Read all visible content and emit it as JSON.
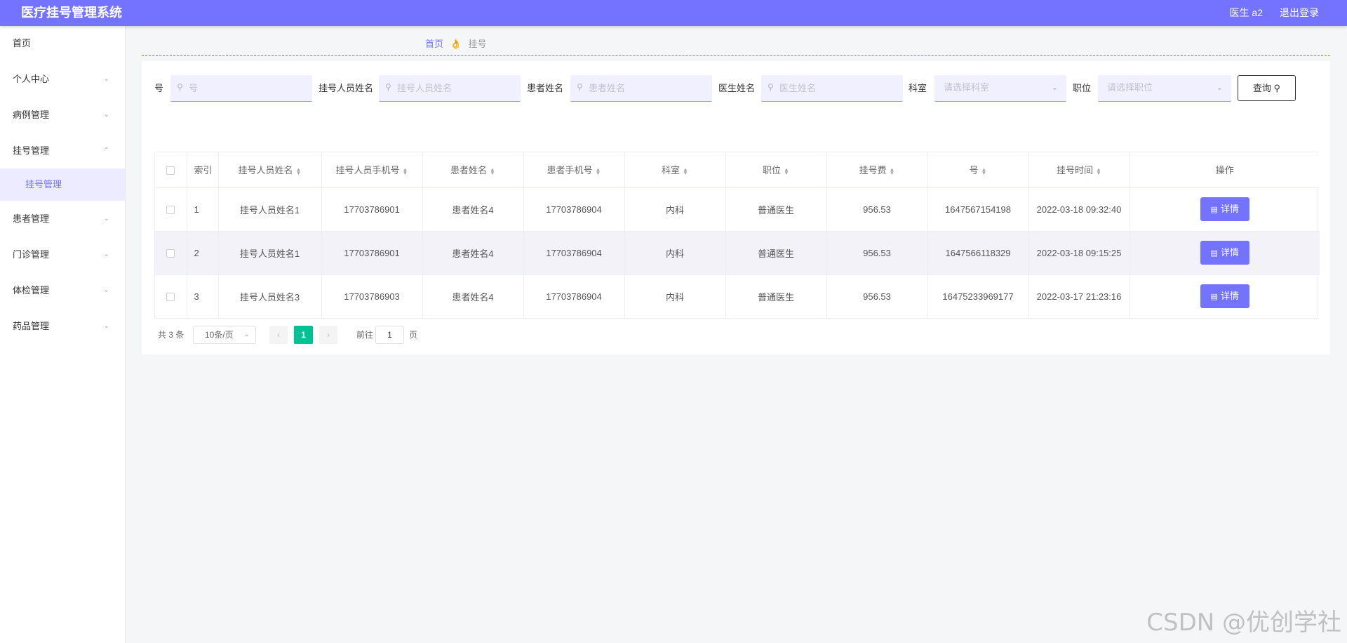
{
  "header": {
    "title": "医疗挂号管理系统",
    "user": "医生 a2",
    "logout": "退出登录"
  },
  "sidebar": {
    "home": "首页",
    "items": [
      {
        "label": "个人中心",
        "arrow": "⌄"
      },
      {
        "label": "病例管理",
        "arrow": "⌄"
      },
      {
        "label": "挂号管理",
        "arrow": "⌃"
      },
      {
        "label": "患者管理",
        "arrow": "⌄"
      },
      {
        "label": "门诊管理",
        "arrow": "⌄"
      },
      {
        "label": "体检管理",
        "arrow": "⌄"
      },
      {
        "label": "药品管理",
        "arrow": "⌄"
      }
    ],
    "sub_item": "挂号管理"
  },
  "breadcrumb": {
    "home": "首页",
    "separator": "👌",
    "current": "挂号"
  },
  "search": {
    "fields": [
      {
        "label": "号",
        "placeholder": "号"
      },
      {
        "label": "挂号人员姓名",
        "placeholder": "挂号人员姓名"
      },
      {
        "label": "患者姓名",
        "placeholder": "患者姓名"
      },
      {
        "label": "医生姓名",
        "placeholder": "医生姓名"
      }
    ],
    "selects": [
      {
        "label": "科室",
        "placeholder": "请选择科室"
      },
      {
        "label": "职位",
        "placeholder": "请选择职位"
      }
    ],
    "query_label": "查询",
    "search_icon": "search-icon"
  },
  "table": {
    "headers": [
      "索引",
      "挂号人员姓名",
      "挂号人员手机号",
      "患者姓名",
      "患者手机号",
      "科室",
      "职位",
      "挂号费",
      "号",
      "挂号时间",
      "操作"
    ],
    "detail_label": "详情",
    "rows": [
      {
        "index": "1",
        "reg_name": "挂号人员姓名1",
        "reg_phone": "17703786901",
        "patient": "患者姓名4",
        "patient_phone": "17703786904",
        "dept": "内科",
        "title": "普通医生",
        "fee": "956.53",
        "no": "1647567154198",
        "time": "2022-03-18 09:32:40"
      },
      {
        "index": "2",
        "reg_name": "挂号人员姓名1",
        "reg_phone": "17703786901",
        "patient": "患者姓名4",
        "patient_phone": "17703786904",
        "dept": "内科",
        "title": "普通医生",
        "fee": "956.53",
        "no": "1647566118329",
        "time": "2022-03-18 09:15:25"
      },
      {
        "index": "3",
        "reg_name": "挂号人员姓名3",
        "reg_phone": "17703786903",
        "patient": "患者姓名4",
        "patient_phone": "17703786904",
        "dept": "内科",
        "title": "普通医生",
        "fee": "956.53",
        "no": "16475233969177",
        "time": "2022-03-17 21:23:16"
      }
    ]
  },
  "pagination": {
    "total": "共 3 条",
    "page_size": "10条/页",
    "current": "1",
    "goto": "前往",
    "goto_value": "1",
    "page_suffix": "页"
  },
  "watermark": "CSDN @优创学社"
}
